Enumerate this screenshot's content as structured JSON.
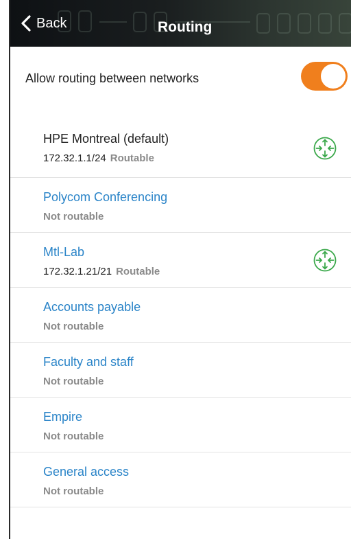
{
  "nav": {
    "back_label": "Back",
    "title": "Routing"
  },
  "routing_toggle": {
    "label": "Allow routing between networks",
    "enabled": true,
    "accent_color": "#f07f1d"
  },
  "networks": [
    {
      "name": "HPE Montreal (default)",
      "address": "172.32.1.1/24",
      "status": "Routable",
      "icon": "router-icon"
    },
    {
      "name": "Polycom Conferencing",
      "address": "",
      "status": "Not routable"
    },
    {
      "name": "Mtl-Lab",
      "address": "172.32.1.21/21",
      "status": "Routable",
      "icon": "router-icon"
    },
    {
      "name": "Accounts payable",
      "address": "",
      "status": "Not routable"
    },
    {
      "name": "Faculty and staff",
      "address": "",
      "status": "Not routable"
    },
    {
      "name": "Empire",
      "address": "",
      "status": "Not routable"
    },
    {
      "name": "General access",
      "address": "",
      "status": "Not routable"
    }
  ],
  "colors": {
    "link": "#2a84c8",
    "router_icon": "#3aa84a",
    "status_gray": "#8a8a8a"
  }
}
